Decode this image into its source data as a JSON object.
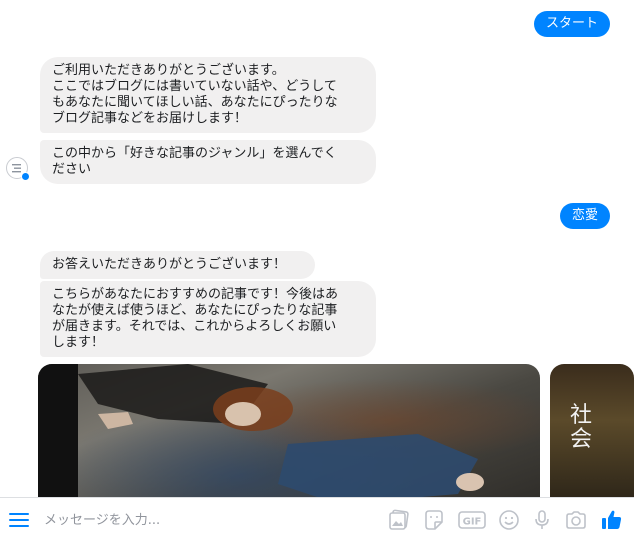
{
  "messages": {
    "start": "スタート",
    "welcome": "ご利用いただきありがとうございます。\nここではブログには書いていない話や、どうして\nもあなたに聞いてほしい話、あなたにぴったりな\nブログ記事などをお届けします！",
    "choose_genre": "この中から「好きな記事のジャンル」を選んでく\nださい",
    "reply_genre": "恋愛",
    "thanks": "お答えいただきありがとうございます！",
    "recommend": "こちらがあなたにおすすめの記事です！今後はあ\nなたが使えば使うほど、あなたにぴったりな記事\nが届きます。それでは、これからよろしくお願い\nします！"
  },
  "cards": {
    "second_sign": "社\n会"
  },
  "composer": {
    "placeholder": "メッセージを入力...",
    "gif_label": "GIF"
  },
  "colors": {
    "accent": "#0084ff",
    "incoming_bubble": "#f1f0f0",
    "icon_gray": "#bec2c9"
  },
  "icons": [
    "menu-icon",
    "image-icon",
    "sticker-icon",
    "gif-icon",
    "emoji-icon",
    "microphone-icon",
    "camera-icon",
    "thumbs-up-icon"
  ]
}
